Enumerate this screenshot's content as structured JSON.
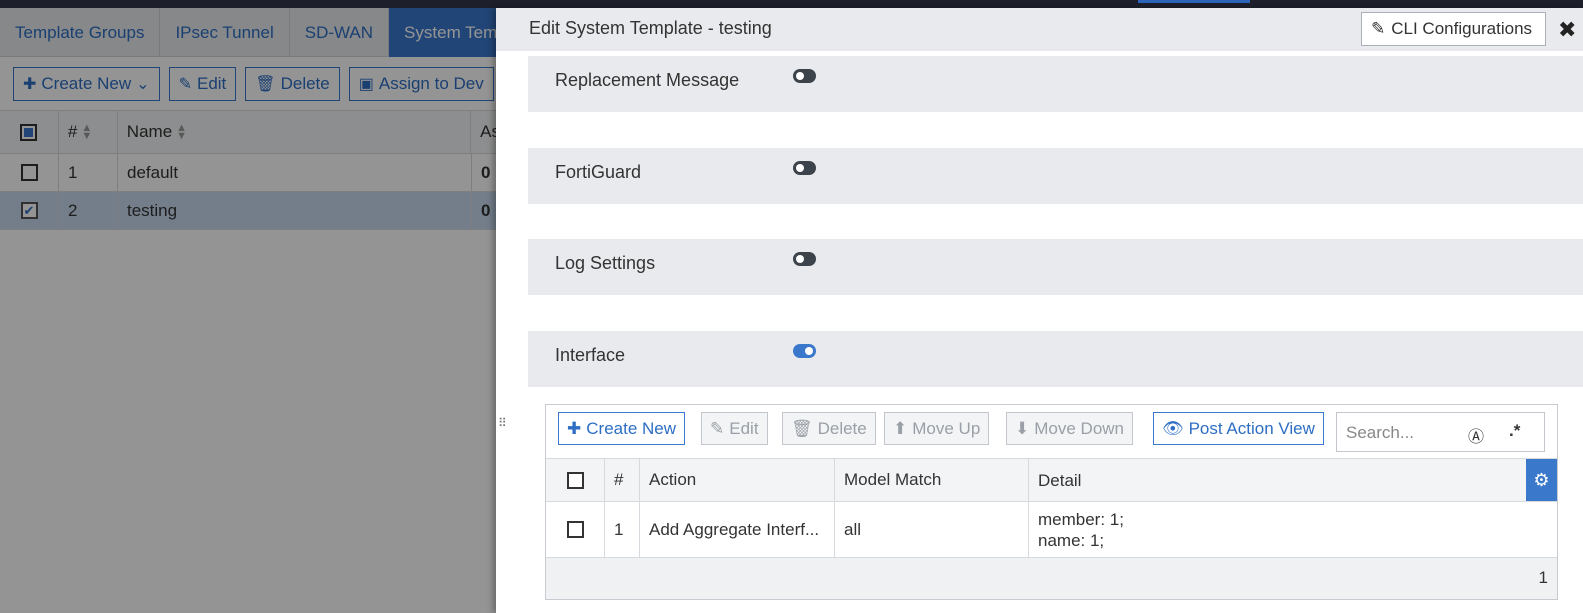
{
  "background": {
    "tabs": [
      "Template Groups",
      "IPsec Tunnel",
      "SD-WAN",
      "System Tem"
    ],
    "active_tab": 3,
    "toolbar": {
      "create_new": "Create New",
      "edit": "Edit",
      "delete": "Delete",
      "assign": "Assign to Dev"
    },
    "table": {
      "headers": {
        "num": "#",
        "name": "Name",
        "assigned": "As"
      },
      "rows": [
        {
          "num": "1",
          "name": "default",
          "assigned": "0",
          "selected": false
        },
        {
          "num": "2",
          "name": "testing",
          "assigned": "0",
          "selected": true
        }
      ]
    }
  },
  "panel": {
    "title": "Edit System Template - testing",
    "cli_button": "CLI Configurations",
    "sections": [
      {
        "label": "Replacement Message",
        "enabled": false
      },
      {
        "label": "FortiGuard",
        "enabled": false
      },
      {
        "label": "Log Settings",
        "enabled": false
      },
      {
        "label": "Interface",
        "enabled": true
      }
    ],
    "interface_table": {
      "toolbar": {
        "create_new": "Create New",
        "edit": "Edit",
        "delete": "Delete",
        "move_up": "Move Up",
        "move_down": "Move Down",
        "post_action_view": "Post Action View",
        "search_placeholder": "Search..."
      },
      "headers": {
        "num": "#",
        "action": "Action",
        "model_match": "Model Match",
        "detail": "Detail"
      },
      "rows": [
        {
          "num": "1",
          "action": "Add Aggregate Interf...",
          "model_match": "all",
          "detail_line1": "member: 1;",
          "detail_line2": "name: 1;"
        }
      ],
      "total": "1"
    }
  },
  "colors": {
    "accent": "#3a78cc",
    "header_bg": "#e8eaed",
    "selected_row": "#c9daf0"
  },
  "icons": [
    "plus-icon",
    "edit-icon",
    "trash-icon",
    "assign-icon",
    "arrow-up-icon",
    "arrow-down-icon",
    "eye-icon",
    "search-icon",
    "regex-icon",
    "gear-icon",
    "close-icon"
  ]
}
